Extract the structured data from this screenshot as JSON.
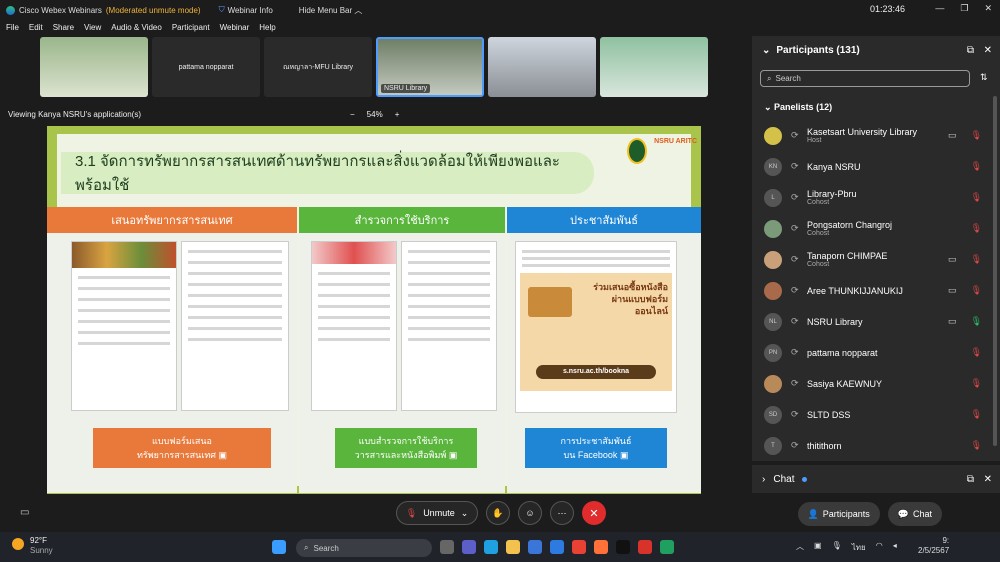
{
  "titlebar": {
    "app": "Cisco Webex Webinars",
    "mode": "(Moderated unmute mode)",
    "webinar_info": "Webinar Info",
    "hide_menu": "Hide Menu Bar",
    "clock": "01:23:46"
  },
  "menu": [
    "File",
    "Edit",
    "Share",
    "View",
    "Audio & Video",
    "Participant",
    "Webinar",
    "Help"
  ],
  "videos": [
    {
      "name": "",
      "kind": "cam1"
    },
    {
      "name": "pattama nopparat",
      "kind": "text"
    },
    {
      "name": "ณหญาลา-MFU Library",
      "kind": "text"
    },
    {
      "name": "NSRU Library",
      "kind": "sel"
    },
    {
      "name": "",
      "kind": "cam4"
    },
    {
      "name": "",
      "kind": "cam6"
    }
  ],
  "viewing": "Viewing Kanya NSRU's application(s)",
  "zoom": {
    "minus": "−",
    "level": "54%",
    "plus": "+"
  },
  "slide": {
    "title": "3.1 จัดการทรัพยากรสารสนเทศด้านทรัพยากรและสิ่งแวดล้อมให้เพียงพอและพร้อมใช้",
    "logo_text": "NSRU ARITC",
    "col1": {
      "head": "เสนอทรัพยากรสารสนเทศ",
      "btn1": "แบบฟอร์มเสนอ",
      "btn2": "ทรัพยากรสารสนเทศ"
    },
    "col2": {
      "head": "สำรวจการใช้บริการ",
      "btn1": "แบบสำรวจการใช้บริการ",
      "btn2": "วารสารและหนังสือพิมพ์"
    },
    "col3": {
      "head": "ประชาสัมพันธ์",
      "btn1": "การประชาสัมพันธ์",
      "btn2": "บน Facebook",
      "poster1": "ร่วมเสนอซื้อหนังสือ",
      "poster2": "ผ่านแบบฟอร์ม",
      "poster3": "ออนไลน์",
      "poster_url": "s.nsru.ac.th/bookna"
    },
    "colors": {
      "orange": "#e8793a",
      "green": "#59b53b",
      "blue": "#1f86d6"
    }
  },
  "participants": {
    "title": "Participants (131)",
    "search_placeholder": "Search",
    "panelists_title": "Panelists (12)"
  },
  "panelists": [
    {
      "name": "Kasetsart University Library",
      "role": "Host",
      "initials": "",
      "video": true
    },
    {
      "name": "Kanya NSRU",
      "role": "",
      "initials": "KN",
      "video": false
    },
    {
      "name": "Library-Pbru",
      "role": "Cohost",
      "initials": "L",
      "video": false
    },
    {
      "name": "Pongsatorn Changroj",
      "role": "Cohost",
      "initials": "",
      "video": false
    },
    {
      "name": "Tanaporn CHIMPAE",
      "role": "Cohost",
      "initials": "",
      "video": true
    },
    {
      "name": "Aree THUNKIJJANUKIJ",
      "role": "",
      "initials": "",
      "video": true
    },
    {
      "name": "NSRU Library",
      "role": "",
      "initials": "NL",
      "video": true
    },
    {
      "name": "pattama nopparat",
      "role": "",
      "initials": "PN",
      "video": false
    },
    {
      "name": "Sasiya KAEWNUY",
      "role": "",
      "initials": "",
      "video": false
    },
    {
      "name": "SLTD DSS",
      "role": "",
      "initials": "SD",
      "video": false
    },
    {
      "name": "thitithorn",
      "role": "",
      "initials": "T",
      "video": false
    }
  ],
  "chat": {
    "label": "Chat"
  },
  "controls": {
    "unmute": "Unmute",
    "participants": "Participants",
    "chat": "Chat"
  },
  "taskbar": {
    "temp": "92°F",
    "weather": "Sunny",
    "search": "Search",
    "time": "9:",
    "date": "2/5/2567",
    "lang": "ไทย"
  }
}
